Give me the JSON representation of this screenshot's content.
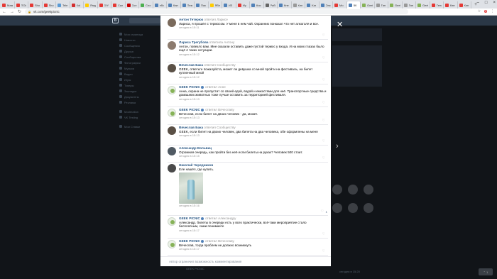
{
  "browser": {
    "tabs": [
      {
        "label": "Мамо",
        "color": "#e53935"
      },
      {
        "label": "ПОИ",
        "color": "#e53935"
      },
      {
        "label": "Sho",
        "color": "#e53935"
      },
      {
        "label": "Sho",
        "color": "#e53935"
      },
      {
        "label": "Tele",
        "color": "#5b9bd5"
      },
      {
        "label": "Kol",
        "color": "#d32f2f"
      },
      {
        "label": "Яндс",
        "color": "#ffcc00"
      },
      {
        "label": "DIY",
        "color": "#e53935"
      },
      {
        "label": "Ски",
        "color": "#e53935"
      },
      {
        "label": "Скл",
        "color": "#cc0000"
      },
      {
        "label": "Сло",
        "color": "#4caf50"
      },
      {
        "label": "ебс",
        "color": "#5181b8"
      },
      {
        "label": "Кап",
        "color": "#5181b8"
      },
      {
        "label": "Пем",
        "color": "#5181b8"
      },
      {
        "label": "Пак",
        "color": "#5181b8"
      },
      {
        "label": "Ябл",
        "color": "#ffcc00"
      },
      {
        "label": "ИЗ",
        "color": "#5181b8"
      },
      {
        "label": "Му",
        "color": "#e53935"
      },
      {
        "label": "Кис",
        "color": "#5181b8"
      },
      {
        "label": "Рабо",
        "color": "#666666"
      },
      {
        "label": "Кне",
        "color": "#5181b8"
      },
      {
        "label": "Клн",
        "color": "#999999"
      },
      {
        "label": "Kar",
        "color": "#5181b8"
      },
      {
        "label": "Опс",
        "color": "#5181b8"
      },
      {
        "label": "Мо",
        "color": "#e53935"
      },
      {
        "label": "ВК",
        "color": "#5181b8",
        "active": true
      },
      {
        "label": "Geek",
        "color": "#86b257"
      },
      {
        "label": "Тяп",
        "color": "#999999"
      },
      {
        "label": "Geek",
        "color": "#86b257"
      },
      {
        "label": "Тяп",
        "color": "#999999"
      },
      {
        "label": "Geek",
        "color": "#86b257"
      },
      {
        "label": "Тепс",
        "color": "#e53935"
      },
      {
        "label": "Кэн",
        "color": "#e53935"
      },
      {
        "label": "Кэн",
        "color": "#e53935"
      }
    ],
    "new_tab": "+",
    "window_controls": [
      "–",
      "□",
      "×"
    ],
    "url": "vk.com/geekpicnic",
    "badge": "2"
  },
  "comments": [
    {
      "name": "Антон Тетерюк",
      "reply_to": "ответил Ларисе",
      "text": "Лариса, я прошёл с термосом. У меня в нем чай. Охранник понюхал что нет алкоголя и все.",
      "date": "сегодня в 15:11",
      "reply": "",
      "avatar": "c1"
    },
    {
      "name": "Лариса Трегубова",
      "reply_to": "ответила Антону",
      "text": "Антон, повезло вам. Мне сказали оставить даже пустой термос у входа. И на моих глазах было ещё 4 таких ситуации.",
      "date": "сегодня в 15:12",
      "reply": "",
      "avatar": "c2"
    },
    {
      "name": "Вячеслав Бака",
      "reply_to": "ответил Сообществу",
      "text": "GEEK, ответьте пожалуйста, может ли девушка со мной пройти на фестиваль, на билет купленный мной",
      "date": "сегодня в 15:12",
      "reply": "",
      "avatar": "c3"
    },
    {
      "name": "GEEK PICNIC",
      "reply_to": "ответил Анне",
      "text": "Анна, охрана не пропустит со своей едой, водой и емкостями для неё. Транспортные средства и домашних животных тоже лучше оставить за территорией фестиваля.",
      "date": "сегодня в 15:13",
      "reply": "",
      "avatar": "geek",
      "verified": true
    },
    {
      "name": "GEEK PICNIC",
      "reply_to": "ответил Вячеславу",
      "text": "Вячеслав, если билет на двоих человек - да, может.",
      "date": "сегодня в 15:13",
      "reply": "",
      "avatar": "geek",
      "verified": true
    },
    {
      "name": "Вячеслав Бака",
      "reply_to": "ответил Сообществу",
      "text": "GEEK, если билет на двоих человек, два билета на два человека, обе оформлены на меня",
      "date": "сегодня в 15:13",
      "reply": "",
      "avatar": "c3"
    },
    {
      "name": "Александр Вольвиц",
      "reply_to": "",
      "text": "Огромная очередь, как пройти без неё если билеты на руках? Человек 500 стоит.",
      "date": "сегодня в 15:15",
      "reply": "",
      "avatar": "c4"
    },
    {
      "name": "Николай Чередников",
      "reply_to": "",
      "text": "Еле нашёл, где купить.",
      "date": "сегодня в 15:16",
      "reply": "",
      "avatar": "c5",
      "photo": true,
      "likes": "1"
    },
    {
      "name": "GEEK PICNIC",
      "reply_to": "ответил Александру",
      "text": "Александр, билеты в очереди есть у всех практически, всё-таки мероприятие стало бесплатным, сами понимаете",
      "date": "сегодня в 15:17",
      "reply": "",
      "avatar": "geek",
      "verified": true
    },
    {
      "name": "GEEK PICNIC",
      "reply_to": "ответил Вячеславу",
      "text": "Вячеслав, тогда проблем не должно возникнуть",
      "date": "сегодня в 15:17",
      "reply": "",
      "avatar": "geek",
      "verified": true
    }
  ],
  "footer_note": "Автор ограничил возможность комментирования",
  "close_glyph": "✕",
  "next_glyph": "›",
  "background": {
    "sidebar_items": [
      "Моя страница",
      "Новости",
      "Сообщения",
      "Друзья",
      "Сообщества",
      "Фотографии",
      "Музыка",
      "Видео",
      "Игры",
      "Товары",
      "Закладки",
      "Документы",
      "Реклама",
      "",
      "Moderation",
      "VK Testing",
      "",
      "Мои Ставки"
    ],
    "bottom_left": "GEEK PICNIC",
    "bottom_right": "сегодня в 15:20",
    "scroll_button": "⌃ 1"
  }
}
